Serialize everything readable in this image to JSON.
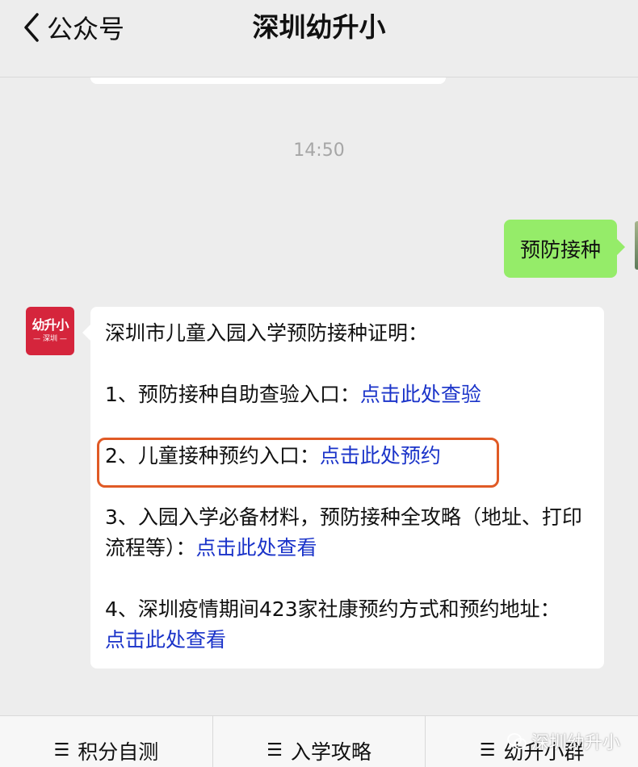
{
  "header": {
    "back_label": "公众号",
    "title": "深圳幼升小"
  },
  "chat": {
    "timestamp": "14:50",
    "user_message": "预防接种",
    "bot_avatar": {
      "main": "幼升小",
      "sub": "— 深圳 —"
    },
    "bot_message": {
      "intro": "深圳市儿童入园入学预防接种证明：",
      "items": [
        {
          "text": "1、预防接种自助查验入口：",
          "link": "点击此处查验"
        },
        {
          "text": "2、儿童接种预约入口：",
          "link": "点击此处预约"
        },
        {
          "text": "3、入园入学必备材料，预防接种全攻略（地址、打印流程等）：",
          "link": "点击此处查看"
        },
        {
          "text": "4、深圳疫情期间423家社康预约方式和预约地址：",
          "link": "点击此处查看"
        }
      ]
    }
  },
  "menu": {
    "items": [
      {
        "label": "积分自测"
      },
      {
        "label": "入学攻略"
      },
      {
        "label": "幼升小群"
      }
    ]
  },
  "watermark": "深圳幼升小",
  "colors": {
    "background": "#ededed",
    "user_bubble": "#95ec69",
    "link": "#1a33c9",
    "highlight": "#e05a25",
    "avatar": "#d5253c"
  }
}
